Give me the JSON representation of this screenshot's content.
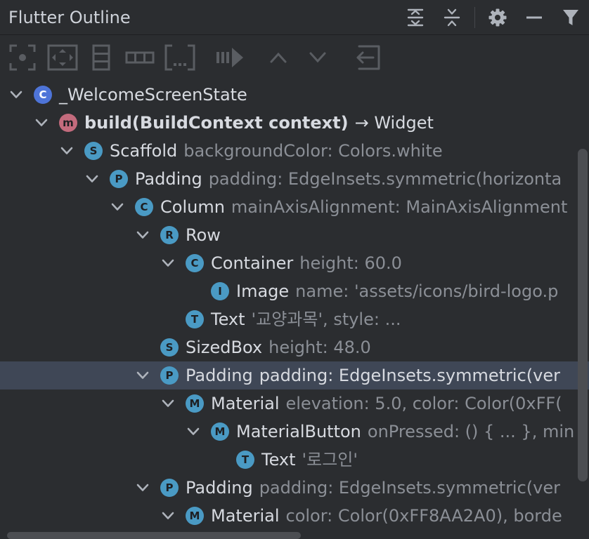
{
  "panel": {
    "title": "Flutter Outline"
  },
  "title_actions": [
    "expand-all-icon",
    "collapse-all-icon",
    "gear-icon",
    "minimize-icon",
    "filter-icon"
  ],
  "toolbar": {
    "tools": [
      "wrap-center-icon",
      "wrap-padding-icon",
      "wrap-column-icon",
      "wrap-row-icon",
      "wrap-container-icon",
      "extract-widget-icon",
      "move-up-icon",
      "move-down-icon",
      "remove-widget-icon"
    ]
  },
  "tree": {
    "rows": [
      {
        "depth": 0,
        "expanded": true,
        "badge": "C",
        "kind": "class",
        "name": "_WelcomeScreenState",
        "detail": ""
      },
      {
        "depth": 1,
        "expanded": true,
        "badge": "m",
        "kind": "method",
        "name": "build(BuildContext context)",
        "detail": "→ Widget"
      },
      {
        "depth": 2,
        "expanded": true,
        "badge": "S",
        "kind": "widget",
        "name": "Scaffold",
        "detail": "backgroundColor: Colors.white"
      },
      {
        "depth": 3,
        "expanded": true,
        "badge": "P",
        "kind": "widget",
        "name": "Padding",
        "detail": "padding: EdgeInsets.symmetric(horizonta"
      },
      {
        "depth": 4,
        "expanded": true,
        "badge": "C",
        "kind": "widget",
        "name": "Column",
        "detail": "mainAxisAlignment: MainAxisAlignment"
      },
      {
        "depth": 5,
        "expanded": true,
        "badge": "R",
        "kind": "widget",
        "name": "Row",
        "detail": ""
      },
      {
        "depth": 6,
        "expanded": true,
        "badge": "C",
        "kind": "widget",
        "name": "Container",
        "detail": "height: 60.0"
      },
      {
        "depth": 7,
        "expanded": false,
        "badge": "I",
        "kind": "widget",
        "name": "Image",
        "detail": "name: 'assets/icons/bird-logo.p"
      },
      {
        "depth": 6,
        "expanded": false,
        "badge": "T",
        "kind": "widget",
        "name": "Text",
        "detail": "'교양과목', style: ..."
      },
      {
        "depth": 5,
        "expanded": false,
        "badge": "S",
        "kind": "widget",
        "name": "SizedBox",
        "detail": "height: 48.0"
      },
      {
        "depth": 5,
        "expanded": true,
        "badge": "P",
        "kind": "widget",
        "name": "Padding",
        "detail": "padding: EdgeInsets.symmetric(ver",
        "selected": true
      },
      {
        "depth": 6,
        "expanded": true,
        "badge": "M",
        "kind": "widget",
        "name": "Material",
        "detail": "elevation: 5.0, color: Color(0xFF("
      },
      {
        "depth": 7,
        "expanded": true,
        "badge": "M",
        "kind": "widget",
        "name": "MaterialButton",
        "detail": "onPressed: () { ... }, min"
      },
      {
        "depth": 8,
        "expanded": false,
        "badge": "T",
        "kind": "widget",
        "name": "Text",
        "detail": "'로그인'"
      },
      {
        "depth": 5,
        "expanded": true,
        "badge": "P",
        "kind": "widget",
        "name": "Padding",
        "detail": "padding: EdgeInsets.symmetric(ver"
      },
      {
        "depth": 6,
        "expanded": true,
        "badge": "M",
        "kind": "widget",
        "name": "Material",
        "detail": "color: Color(0xFF8AA2A0), borde"
      }
    ]
  }
}
